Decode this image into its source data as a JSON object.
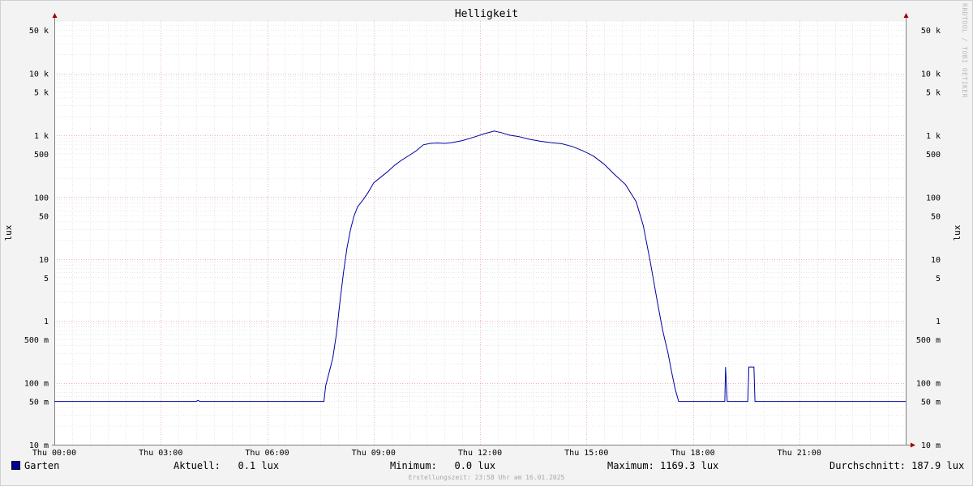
{
  "title": "Helligkeit",
  "watermark": "RRDTOOL / TOBI OETIKER",
  "footer": "Erstellungszeit: 23:58 Uhr am 16.01.2025",
  "legend": {
    "series_name": "Garten",
    "current": "Aktuell:   0.1 lux",
    "minimum": "Minimum:   0.0 lux",
    "maximum": "Maximum: 1169.3 lux",
    "average": "Durchschnitt: 187.9 lux"
  },
  "colors": {
    "series": "#0000a0",
    "major_grid": "#e8a0a0",
    "minor_grid": "#d8d8d8",
    "axis": "#808080",
    "arrow": "#a00000"
  },
  "chart_data": {
    "type": "line",
    "title": "Helligkeit",
    "ylabel": "lux",
    "yscale": "log",
    "ylim": [
      0.01,
      70000
    ],
    "xlim": [
      0,
      24
    ],
    "x_unit": "hours",
    "x_ticks": [
      {
        "value": 0,
        "label": "Thu 00:00"
      },
      {
        "value": 3,
        "label": "Thu 03:00"
      },
      {
        "value": 6,
        "label": "Thu 06:00"
      },
      {
        "value": 9,
        "label": "Thu 09:00"
      },
      {
        "value": 12,
        "label": "Thu 12:00"
      },
      {
        "value": 15,
        "label": "Thu 15:00"
      },
      {
        "value": 18,
        "label": "Thu 18:00"
      },
      {
        "value": 21,
        "label": "Thu 21:00"
      }
    ],
    "y_ticks": [
      {
        "value": 50000,
        "label": "50 k"
      },
      {
        "value": 10000,
        "label": "10 k"
      },
      {
        "value": 5000,
        "label": "5 k"
      },
      {
        "value": 1000,
        "label": "1 k"
      },
      {
        "value": 500,
        "label": "500"
      },
      {
        "value": 100,
        "label": "100"
      },
      {
        "value": 50,
        "label": "50"
      },
      {
        "value": 10,
        "label": "10"
      },
      {
        "value": 5,
        "label": "5"
      },
      {
        "value": 1,
        "label": "1"
      },
      {
        "value": 0.5,
        "label": "500 m"
      },
      {
        "value": 0.1,
        "label": "100 m"
      },
      {
        "value": 0.05,
        "label": "50 m"
      },
      {
        "value": 0.01,
        "label": "10 m"
      }
    ],
    "grid": true,
    "legend_position": "bottom",
    "series": [
      {
        "name": "Garten",
        "x": [
          0,
          4.0,
          4.05,
          4.1,
          7.6,
          7.65,
          7.75,
          7.85,
          7.95,
          8.05,
          8.15,
          8.25,
          8.35,
          8.45,
          8.55,
          8.7,
          8.85,
          9.0,
          9.2,
          9.4,
          9.6,
          9.8,
          10.0,
          10.2,
          10.4,
          10.6,
          10.8,
          11.0,
          11.2,
          11.5,
          11.8,
          12.1,
          12.4,
          12.6,
          12.85,
          13.1,
          13.4,
          13.7,
          14.0,
          14.3,
          14.6,
          14.9,
          15.2,
          15.5,
          15.8,
          16.1,
          16.4,
          16.6,
          16.8,
          17.0,
          17.15,
          17.3,
          17.4,
          17.5,
          17.6,
          17.7,
          17.8,
          17.9,
          17.95,
          18.0,
          18.9,
          18.92,
          18.97,
          19.0,
          19.55,
          19.58,
          19.72,
          19.75,
          24
        ],
        "y": [
          0.05,
          0.05,
          0.052,
          0.05,
          0.05,
          0.09,
          0.15,
          0.25,
          0.6,
          2.0,
          6.0,
          15.0,
          30.0,
          50.0,
          70.0,
          90.0,
          120.0,
          170.0,
          210.0,
          260.0,
          330.0,
          400.0,
          470.0,
          560.0,
          700.0,
          740.0,
          750.0,
          740.0,
          760.0,
          820.0,
          920.0,
          1050.0,
          1169.3,
          1100.0,
          1000.0,
          950.0,
          860.0,
          800.0,
          760.0,
          730.0,
          660.0,
          560.0,
          460.0,
          340.0,
          230.0,
          160.0,
          85.0,
          35.0,
          9.0,
          2.0,
          0.7,
          0.3,
          0.15,
          0.08,
          0.05,
          0.05,
          0.05,
          0.05,
          0.05,
          0.05,
          0.05,
          0.18,
          0.05,
          0.05,
          0.05,
          0.18,
          0.18,
          0.05,
          0.05
        ]
      }
    ]
  }
}
